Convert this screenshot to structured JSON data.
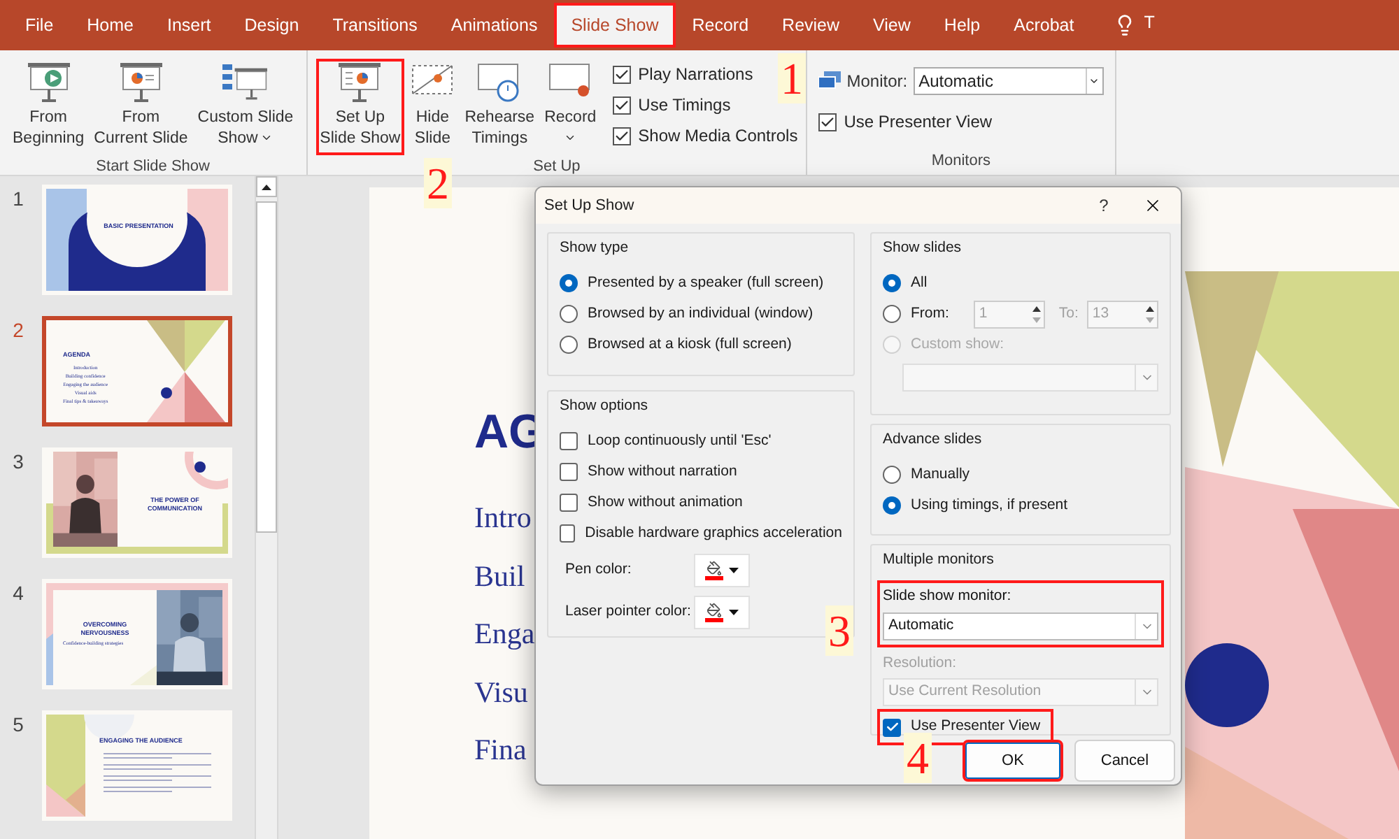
{
  "ribbon_tabs": [
    {
      "label": "File",
      "selected": false,
      "highlighted": false
    },
    {
      "label": "Home",
      "selected": false,
      "highlighted": false
    },
    {
      "label": "Insert",
      "selected": false,
      "highlighted": false
    },
    {
      "label": "Design",
      "selected": false,
      "highlighted": false
    },
    {
      "label": "Transitions",
      "selected": false,
      "highlighted": false
    },
    {
      "label": "Animations",
      "selected": false,
      "highlighted": false
    },
    {
      "label": "Slide Show",
      "selected": true,
      "highlighted": true
    },
    {
      "label": "Record",
      "selected": false,
      "highlighted": false
    },
    {
      "label": "Review",
      "selected": false,
      "highlighted": false
    },
    {
      "label": "View",
      "selected": false,
      "highlighted": false
    },
    {
      "label": "Help",
      "selected": false,
      "highlighted": false
    },
    {
      "label": "Acrobat",
      "selected": false,
      "highlighted": false
    }
  ],
  "tell_me": "T",
  "ribbon_groups": [
    {
      "kind": "buttons",
      "label": "Start Slide Show",
      "buttons": [
        {
          "kind": "play",
          "label": "From\nBeginning",
          "dropdown": false,
          "highlighted": false
        },
        {
          "kind": "current",
          "label": "From\nCurrent Slide",
          "dropdown": false,
          "highlighted": false
        },
        {
          "kind": "custom",
          "label": "Custom Slide\nShow",
          "dropdown": true,
          "highlighted": false
        }
      ]
    },
    {
      "kind": "buttons",
      "label": "Set Up",
      "buttons": [
        {
          "kind": "setup",
          "label": "Set Up\nSlide Show",
          "dropdown": false,
          "highlighted": true
        },
        {
          "kind": "hide",
          "label": "Hide\nSlide",
          "dropdown": false,
          "highlighted": false
        },
        {
          "kind": "rehearse",
          "label": "Rehearse\nTimings",
          "dropdown": false,
          "highlighted": false
        },
        {
          "kind": "record",
          "label": "Record",
          "dropdown": true,
          "highlighted": false
        }
      ],
      "checkboxes": [
        {
          "label": "Play Narrations",
          "checked": true
        },
        {
          "label": "Use Timings",
          "checked": true
        },
        {
          "label": "Show Media Controls",
          "checked": true
        }
      ]
    },
    {
      "kind": "monitors",
      "label": "Monitors",
      "monitor_label": "Monitor:",
      "monitor_value": "Automatic",
      "checkboxes": [
        {
          "label": "Use Presenter View",
          "checked": true
        }
      ]
    }
  ],
  "slides": [
    {
      "number": "1",
      "selected": false,
      "kind": "title",
      "title": "BASIC PRESENTATION"
    },
    {
      "number": "2",
      "selected": true,
      "kind": "agenda",
      "title": "AGENDA",
      "items": [
        "Introduction",
        "Building confidence",
        "Engaging the audience",
        "Visual aids",
        "Final tips & takeaways"
      ]
    },
    {
      "number": "3",
      "selected": false,
      "kind": "photo_left",
      "title": "THE POWER OF COMMUNICATION"
    },
    {
      "number": "4",
      "selected": false,
      "kind": "photo_right",
      "title": "OVERCOMING NERVOUSNESS",
      "subtitle": "Confidence-building strategies"
    },
    {
      "number": "5",
      "selected": false,
      "kind": "bullets",
      "title": "ENGAGING THE AUDIENCE"
    }
  ],
  "slide": {
    "heading": "AG",
    "lines": [
      "Intro",
      "Buil",
      "Enga",
      "Visu",
      "Fina"
    ]
  },
  "dialog": {
    "title": "Set Up Show",
    "help": "?",
    "show_type": {
      "label": "Show type",
      "options": [
        {
          "label": "Presented by a speaker (full screen)",
          "selected": true
        },
        {
          "label": "Browsed by an individual (window)",
          "selected": false
        },
        {
          "label": "Browsed at a kiosk (full screen)",
          "selected": false
        }
      ]
    },
    "show_options": {
      "label": "Show options",
      "checkboxes": [
        {
          "label": "Loop continuously until 'Esc'",
          "checked": false
        },
        {
          "label": "Show without narration",
          "checked": false
        },
        {
          "label": "Show without animation",
          "checked": false
        },
        {
          "label": "Disable hardware graphics acceleration",
          "checked": false
        }
      ],
      "colors": [
        {
          "label": "Pen color:",
          "color": "#ff0000"
        },
        {
          "label": "Laser pointer color:",
          "color": "#ff0000"
        }
      ]
    },
    "show_slides": {
      "label": "Show slides",
      "options": [
        {
          "kind": "all",
          "label": "All",
          "selected": true,
          "disabled": false
        },
        {
          "kind": "range",
          "label": "From:",
          "selected": false,
          "disabled": false,
          "from": "1",
          "to_label": "To:",
          "to": "13"
        },
        {
          "kind": "custom",
          "label": "Custom show:",
          "selected": false,
          "disabled": true
        }
      ]
    },
    "advance_slides": {
      "label": "Advance slides",
      "options": [
        {
          "label": "Manually",
          "selected": false
        },
        {
          "label": "Using timings, if present",
          "selected": true
        }
      ]
    },
    "multiple_monitors": {
      "label": "Multiple monitors",
      "monitor_label": "Slide show monitor:",
      "monitor_value": "Automatic",
      "monitor_highlighted": true,
      "resolution_label": "Resolution:",
      "resolution_value": "Use Current Resolution",
      "resolution_disabled": true,
      "presenter_view": {
        "label": "Use Presenter View",
        "checked": true,
        "highlighted": true
      }
    },
    "buttons": [
      {
        "label": "OK",
        "highlighted": true
      },
      {
        "label": "Cancel",
        "highlighted": false
      }
    ]
  },
  "step_markers": [
    "1",
    "2",
    "3",
    "4"
  ]
}
